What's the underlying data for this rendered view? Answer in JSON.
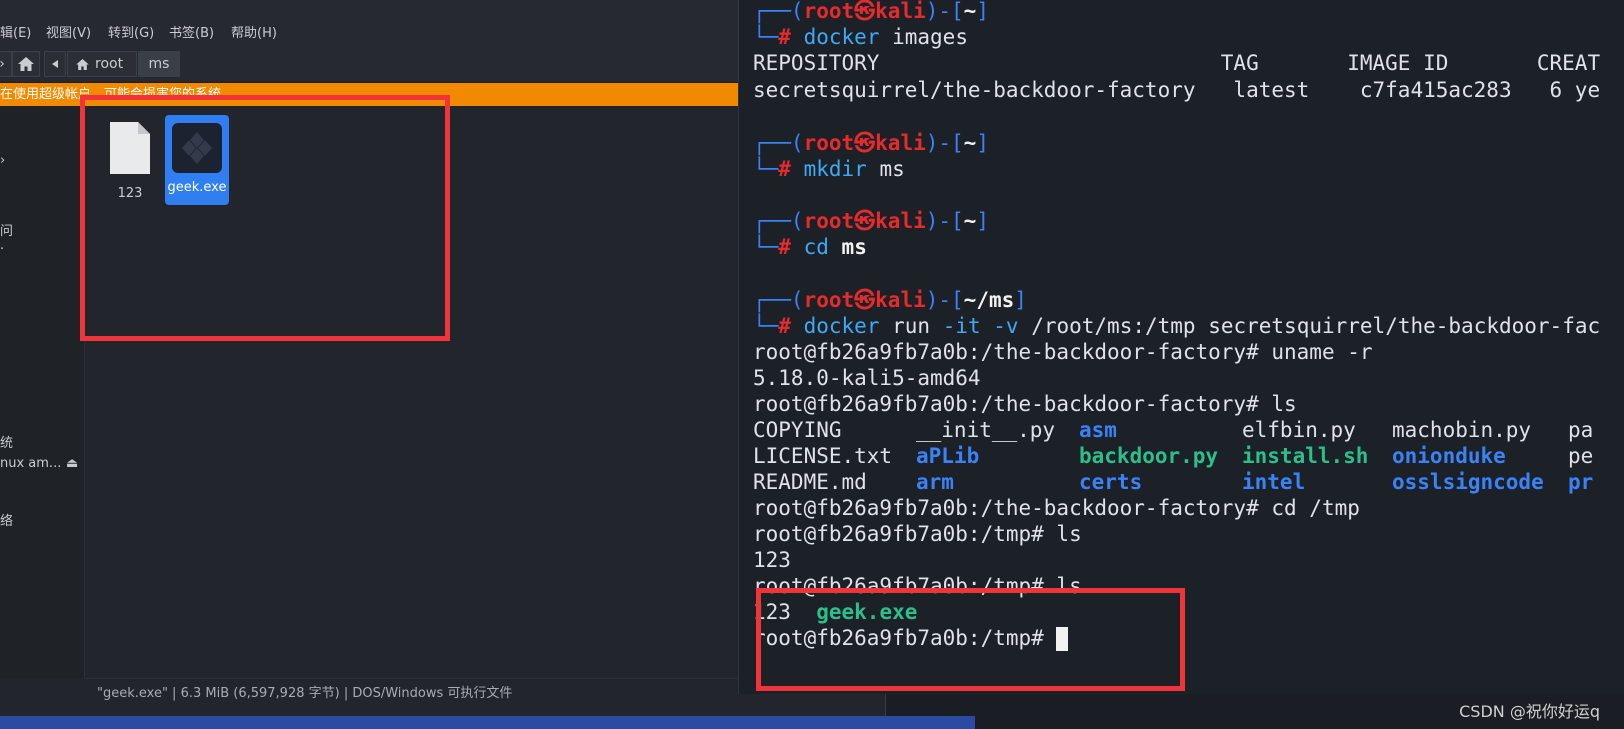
{
  "menubar": {
    "items": [
      "辑(E)",
      "视图(V)",
      "转到(G)",
      "书签(B)",
      "帮助(H)"
    ]
  },
  "toolbar": {
    "breadcrumb_root": "root",
    "breadcrumb_current": "ms"
  },
  "warning": "在使用超级帐户，可能会损害您的系统。",
  "sidebar": {
    "items": [
      "问",
      "统",
      "nux am...",
      "络"
    ]
  },
  "files": [
    {
      "name": "123",
      "icon": "document-icon"
    },
    {
      "name": "geek.exe",
      "icon": "exe-icon"
    }
  ],
  "status_text": "\"geek.exe\" | 6.3 MiB (6,597,928 字节) | DOS/Windows 可执行文件",
  "terminal": {
    "prompt_user": "root",
    "prompt_host": "kali",
    "home_dir": "~",
    "ms_dir": "~/ms",
    "cmd_docker": "docker",
    "cmd_images": " images",
    "images_header": "REPOSITORY                           TAG       IMAGE ID       CREAT",
    "images_row": "secretsquirrel/the-backdoor-factory   latest    c7fa415ac283   6 ye",
    "cmd_mkdir": "mkdir",
    "cmd_mkdir_arg": " ms",
    "cmd_cd": "cd",
    "cmd_cd_arg": " ms",
    "cmd_run_args": " run ",
    "cmd_run_flags": "-it -v",
    "cmd_run_rest": " /root/ms:/tmp secretsquirrel/the-backdoor-fac",
    "l_uname": "root@fb26a9fb7a0b:/the-backdoor-factory# uname -r",
    "l_kernel": "5.18.0-kali5-amd64",
    "l_ls1": "root@fb26a9fb7a0b:/the-backdoor-factory# ls",
    "ls_rows": [
      [
        "COPYING",
        "__init__.py",
        "asm",
        "elfbin.py",
        "machobin.py",
        "pa"
      ],
      [
        "LICENSE.txt",
        "aPLib",
        "backdoor.py",
        "install.sh",
        "onionduke",
        "pe"
      ],
      [
        "README.md",
        "arm",
        "certs",
        "intel",
        "osslsigncode",
        "pr"
      ]
    ],
    "l_cdtmp": "root@fb26a9fb7a0b:/the-backdoor-factory# cd /tmp",
    "l_ls2": "root@fb26a9fb7a0b:/tmp# ls",
    "l_out2": "123",
    "l_ls3": "root@fb26a9fb7a0b:/tmp# ls",
    "l_out3_a": "123",
    "l_out3_b": "geek.exe",
    "l_prompt": "root@fb26a9fb7a0b:/tmp# "
  },
  "watermark": "CSDN @祝你好运q",
  "colors": {
    "warning_bar": "#f28a00",
    "selection": "#2f7ff2",
    "highlight_box": "#f0343a",
    "prompt_user": "#e52b2b",
    "prompt_frame": "#3b82f6",
    "executable": "#2dbf8a"
  }
}
